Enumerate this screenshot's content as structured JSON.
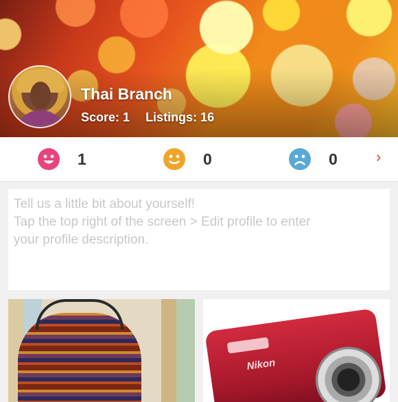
{
  "profile": {
    "name": "Thai Branch",
    "score_label": "Score: 1",
    "listings_label": "Listings: 16"
  },
  "ratings": [
    {
      "icon": "happy-face-icon",
      "color": "#e8457a",
      "count": "1"
    },
    {
      "icon": "neutral-face-icon",
      "color": "#f0a52a",
      "count": "0"
    },
    {
      "icon": "sad-face-icon",
      "color": "#5aa8d8",
      "count": "0"
    }
  ],
  "next_icon": "chevron-right-icon",
  "next_glyph": "›",
  "about": {
    "line1": "Tell us a little bit about yourself!",
    "line2": "Tap the top right of the screen > Edit profile to enter",
    "line3": "your profile description."
  },
  "listings": [
    {
      "image": "patterned-halter-top-photo"
    },
    {
      "image": "red-nikon-camera-photo",
      "brand_text": "Nikon"
    }
  ]
}
